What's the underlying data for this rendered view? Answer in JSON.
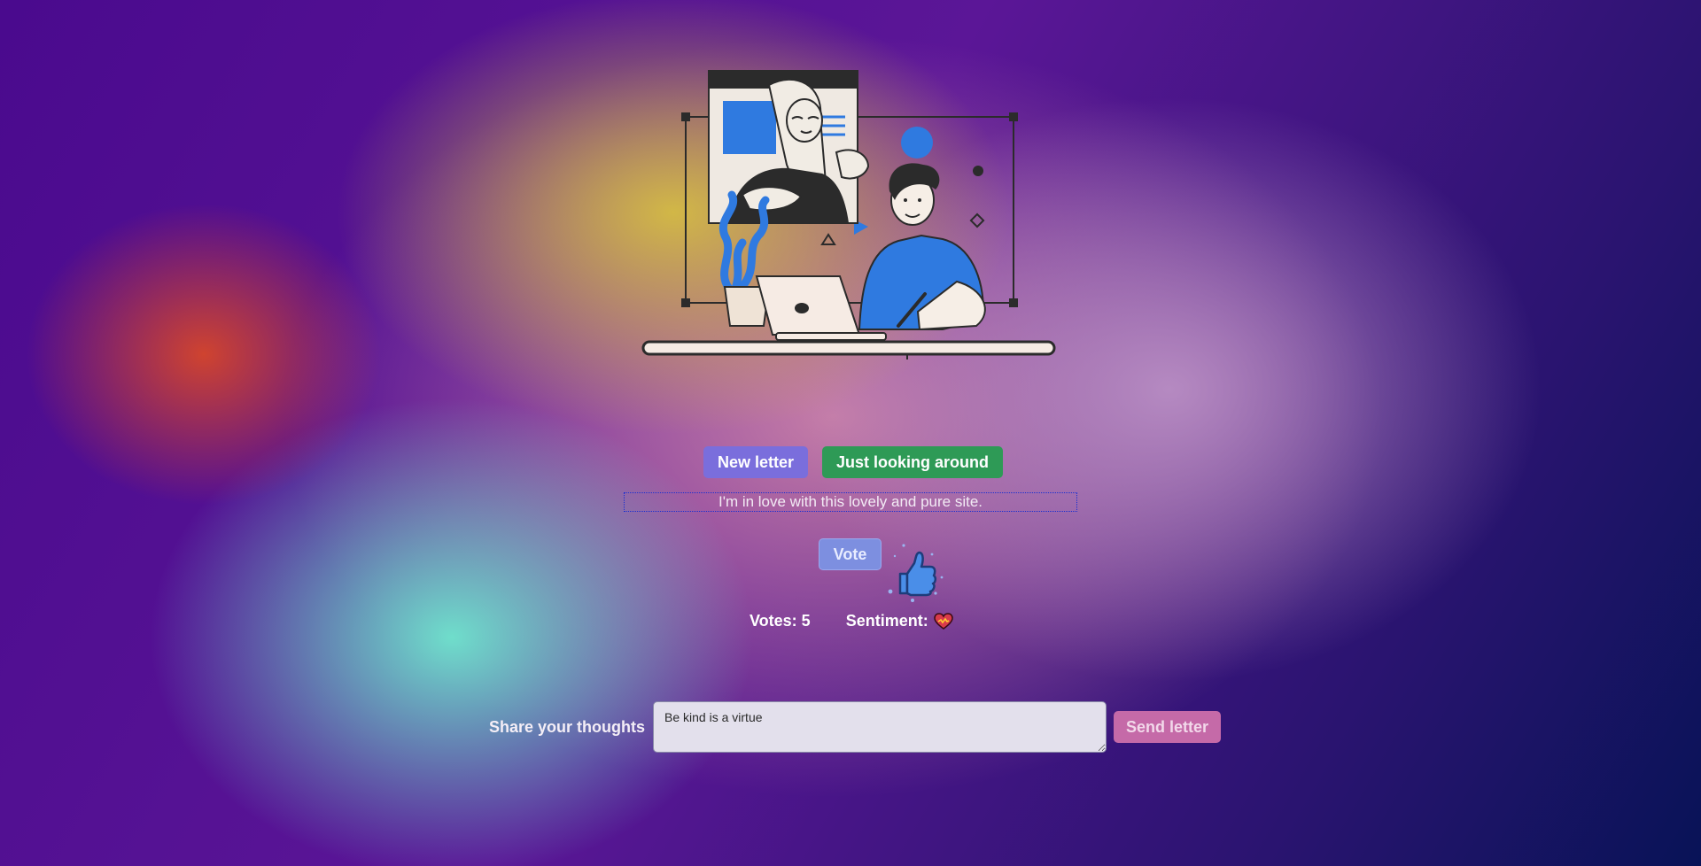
{
  "hero": {
    "illustration": "people-chatting-illustration"
  },
  "actions": {
    "new_letter_label": "New letter",
    "looking_label": "Just looking around"
  },
  "letter": {
    "text": "I'm in love with this lovely and pure site."
  },
  "vote": {
    "label": "Vote",
    "icon": "thumbs-up-icon"
  },
  "stats": {
    "votes_text": "Votes: 5",
    "sentiment_label": "Sentiment:",
    "sentiment_icon": "heart-icon"
  },
  "share": {
    "label": "Share your thoughts",
    "input_value": "Be kind is a virtue",
    "send_label": "Send letter"
  },
  "colors": {
    "new_letter_button": "#7a6edc",
    "looking_button": "#2e9a56",
    "vote_button": "#7d8fe0",
    "send_button": "#c56aa8",
    "accent_blue": "#2f7ae0"
  }
}
